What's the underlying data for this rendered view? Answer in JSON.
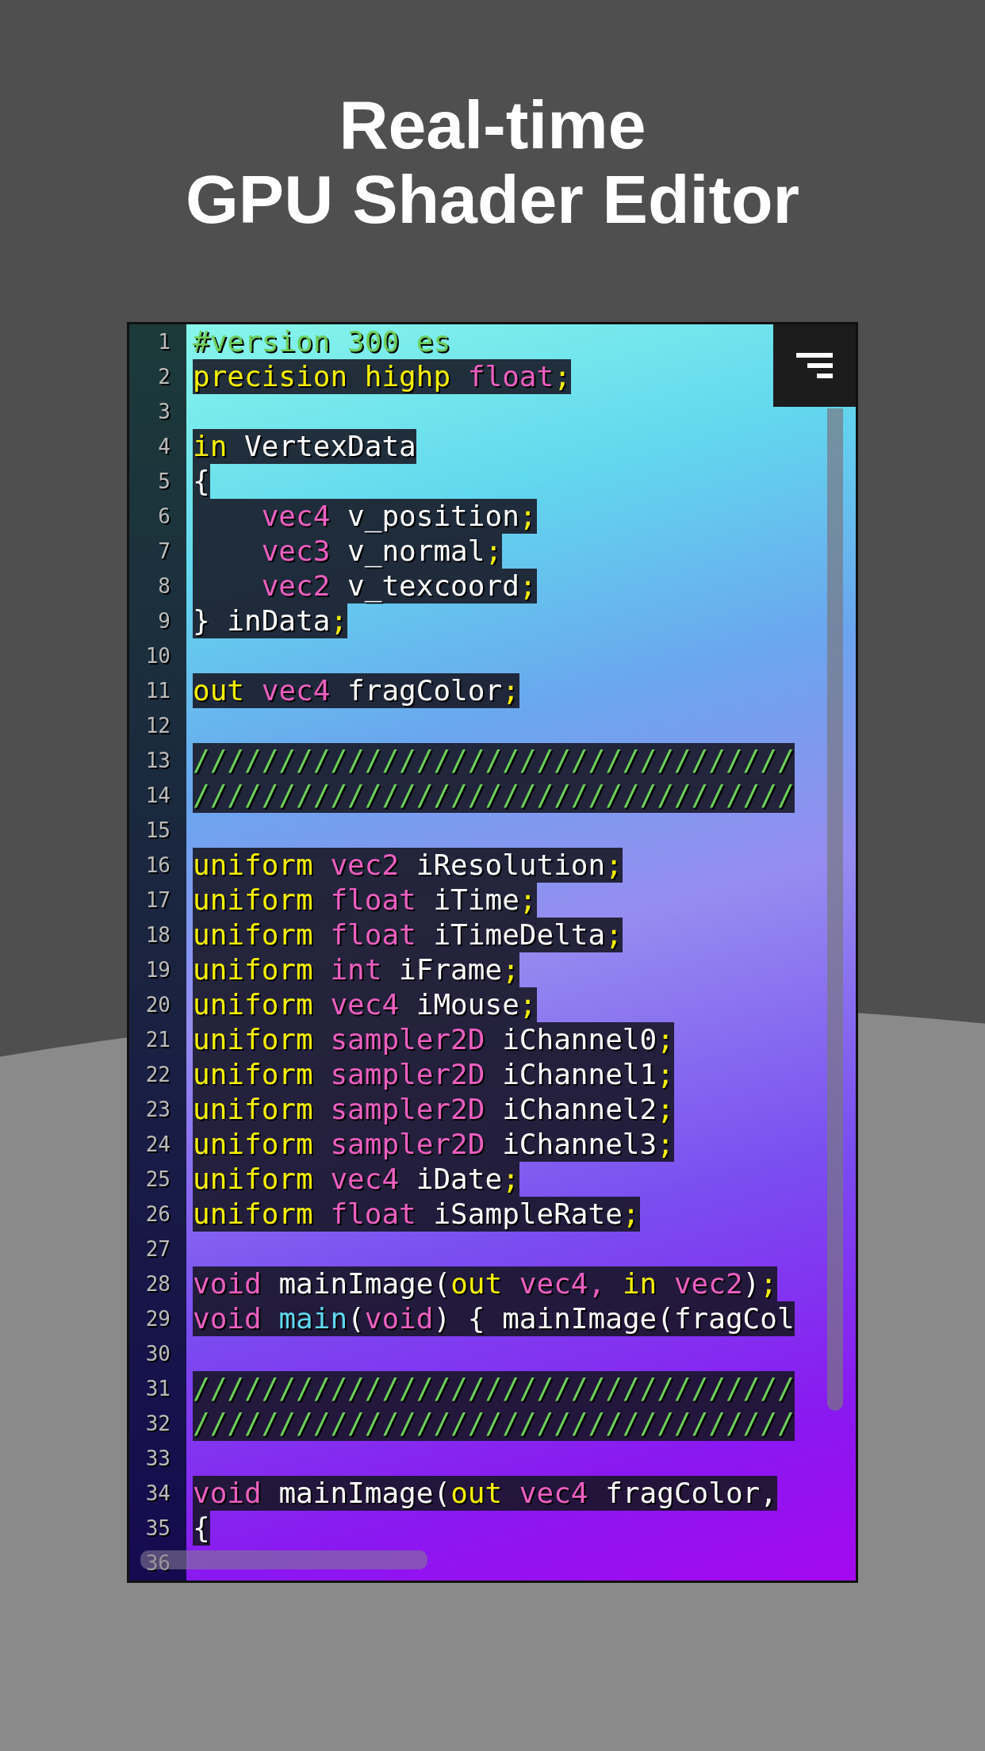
{
  "title": [
    "Real-time",
    "GPU Shader Editor"
  ],
  "editor": {
    "lines": [
      {
        "number": "1",
        "shaded": false,
        "tokens": [
          {
            "kind": "comment",
            "text": "#version 300 es"
          }
        ]
      },
      {
        "number": "2",
        "shaded": true,
        "tokens": [
          {
            "kind": "keyword",
            "text": "precision highp "
          },
          {
            "kind": "type",
            "text": "float"
          },
          {
            "kind": "keyword",
            "text": ";"
          }
        ]
      },
      {
        "number": "3"
      },
      {
        "number": "4",
        "shaded": true,
        "tokens": [
          {
            "kind": "keyword",
            "text": "in "
          },
          {
            "kind": "plain",
            "text": "VertexData"
          }
        ]
      },
      {
        "number": "5",
        "shaded": true,
        "tokens": [
          {
            "kind": "plain",
            "text": "{"
          }
        ]
      },
      {
        "number": "6",
        "shaded": true,
        "tokens": [
          {
            "kind": "type",
            "text": "    vec4 "
          },
          {
            "kind": "plain",
            "text": "v_position"
          },
          {
            "kind": "keyword",
            "text": ";"
          }
        ]
      },
      {
        "number": "7",
        "shaded": true,
        "tokens": [
          {
            "kind": "type",
            "text": "    vec3 "
          },
          {
            "kind": "plain",
            "text": "v_normal"
          },
          {
            "kind": "keyword",
            "text": ";"
          }
        ]
      },
      {
        "number": "8",
        "shaded": true,
        "tokens": [
          {
            "kind": "type",
            "text": "    vec2 "
          },
          {
            "kind": "plain",
            "text": "v_texcoord"
          },
          {
            "kind": "keyword",
            "text": ";"
          }
        ]
      },
      {
        "number": "9",
        "shaded": true,
        "tokens": [
          {
            "kind": "plain",
            "text": "} inData"
          },
          {
            "kind": "keyword",
            "text": ";"
          }
        ]
      },
      {
        "number": "10"
      },
      {
        "number": "11",
        "shaded": true,
        "tokens": [
          {
            "kind": "keyword",
            "text": "out "
          },
          {
            "kind": "type",
            "text": "vec4 "
          },
          {
            "kind": "plain",
            "text": "fragColor"
          },
          {
            "kind": "keyword",
            "text": ";"
          }
        ]
      },
      {
        "number": "12"
      },
      {
        "number": "13",
        "shaded": true,
        "tokens": [
          {
            "kind": "comment",
            "text": "///////////////////////////////////"
          }
        ]
      },
      {
        "number": "14",
        "shaded": true,
        "tokens": [
          {
            "kind": "comment",
            "text": "///////////////////////////////////"
          }
        ]
      },
      {
        "number": "15"
      },
      {
        "number": "16",
        "shaded": true,
        "tokens": [
          {
            "kind": "keyword",
            "text": "uniform "
          },
          {
            "kind": "type",
            "text": "vec2 "
          },
          {
            "kind": "plain",
            "text": "iResolution"
          },
          {
            "kind": "keyword",
            "text": ";"
          }
        ]
      },
      {
        "number": "17",
        "shaded": true,
        "tokens": [
          {
            "kind": "keyword",
            "text": "uniform "
          },
          {
            "kind": "type",
            "text": "float "
          },
          {
            "kind": "plain",
            "text": "iTime"
          },
          {
            "kind": "keyword",
            "text": ";"
          }
        ]
      },
      {
        "number": "18",
        "shaded": true,
        "tokens": [
          {
            "kind": "keyword",
            "text": "uniform "
          },
          {
            "kind": "type",
            "text": "float "
          },
          {
            "kind": "plain",
            "text": "iTimeDelta"
          },
          {
            "kind": "keyword",
            "text": ";"
          }
        ]
      },
      {
        "number": "19",
        "shaded": true,
        "tokens": [
          {
            "kind": "keyword",
            "text": "uniform "
          },
          {
            "kind": "type",
            "text": "int "
          },
          {
            "kind": "plain",
            "text": "iFrame"
          },
          {
            "kind": "keyword",
            "text": ";"
          }
        ]
      },
      {
        "number": "20",
        "shaded": true,
        "tokens": [
          {
            "kind": "keyword",
            "text": "uniform "
          },
          {
            "kind": "type",
            "text": "vec4 "
          },
          {
            "kind": "plain",
            "text": "iMouse"
          },
          {
            "kind": "keyword",
            "text": ";"
          }
        ]
      },
      {
        "number": "21",
        "shaded": true,
        "tokens": [
          {
            "kind": "keyword",
            "text": "uniform "
          },
          {
            "kind": "type",
            "text": "sampler2D "
          },
          {
            "kind": "plain",
            "text": "iChannel0"
          },
          {
            "kind": "keyword",
            "text": ";"
          }
        ]
      },
      {
        "number": "22",
        "shaded": true,
        "tokens": [
          {
            "kind": "keyword",
            "text": "uniform "
          },
          {
            "kind": "type",
            "text": "sampler2D "
          },
          {
            "kind": "plain",
            "text": "iChannel1"
          },
          {
            "kind": "keyword",
            "text": ";"
          }
        ]
      },
      {
        "number": "23",
        "shaded": true,
        "tokens": [
          {
            "kind": "keyword",
            "text": "uniform "
          },
          {
            "kind": "type",
            "text": "sampler2D "
          },
          {
            "kind": "plain",
            "text": "iChannel2"
          },
          {
            "kind": "keyword",
            "text": ";"
          }
        ]
      },
      {
        "number": "24",
        "shaded": true,
        "tokens": [
          {
            "kind": "keyword",
            "text": "uniform "
          },
          {
            "kind": "type",
            "text": "sampler2D "
          },
          {
            "kind": "plain",
            "text": "iChannel3"
          },
          {
            "kind": "keyword",
            "text": ";"
          }
        ]
      },
      {
        "number": "25",
        "shaded": true,
        "tokens": [
          {
            "kind": "keyword",
            "text": "uniform "
          },
          {
            "kind": "type",
            "text": "vec4 "
          },
          {
            "kind": "plain",
            "text": "iDate"
          },
          {
            "kind": "keyword",
            "text": ";"
          }
        ]
      },
      {
        "number": "26",
        "shaded": true,
        "tokens": [
          {
            "kind": "keyword",
            "text": "uniform "
          },
          {
            "kind": "type",
            "text": "float "
          },
          {
            "kind": "plain",
            "text": "iSampleRate"
          },
          {
            "kind": "keyword",
            "text": ";"
          }
        ]
      },
      {
        "number": "27"
      },
      {
        "number": "28",
        "shaded": true,
        "tokens": [
          {
            "kind": "type",
            "text": "void "
          },
          {
            "kind": "plain",
            "text": "mainImage("
          },
          {
            "kind": "keyword",
            "text": "out "
          },
          {
            "kind": "type",
            "text": "vec4, "
          },
          {
            "kind": "keyword",
            "text": "in "
          },
          {
            "kind": "type",
            "text": "vec2"
          },
          {
            "kind": "plain",
            "text": ")"
          },
          {
            "kind": "keyword",
            "text": ";"
          }
        ]
      },
      {
        "number": "29",
        "shaded": true,
        "tokens": [
          {
            "kind": "type",
            "text": "void "
          },
          {
            "kind": "function",
            "text": "main"
          },
          {
            "kind": "plain",
            "text": "("
          },
          {
            "kind": "type",
            "text": "void"
          },
          {
            "kind": "plain",
            "text": ") { mainImage(fragCol"
          }
        ]
      },
      {
        "number": "30"
      },
      {
        "number": "31",
        "shaded": true,
        "tokens": [
          {
            "kind": "comment",
            "text": "///////////////////////////////////"
          }
        ]
      },
      {
        "number": "32",
        "shaded": true,
        "tokens": [
          {
            "kind": "comment",
            "text": "///////////////////////////////////"
          }
        ]
      },
      {
        "number": "33"
      },
      {
        "number": "34",
        "shaded": true,
        "tokens": [
          {
            "kind": "type",
            "text": "void "
          },
          {
            "kind": "plain",
            "text": "mainImage("
          },
          {
            "kind": "keyword",
            "text": "out "
          },
          {
            "kind": "type",
            "text": "vec4 "
          },
          {
            "kind": "plain",
            "text": "fragColor,"
          }
        ]
      },
      {
        "number": "35",
        "shaded": true,
        "tokens": [
          {
            "kind": "plain",
            "text": "{"
          }
        ]
      },
      {
        "number": "36"
      }
    ]
  }
}
